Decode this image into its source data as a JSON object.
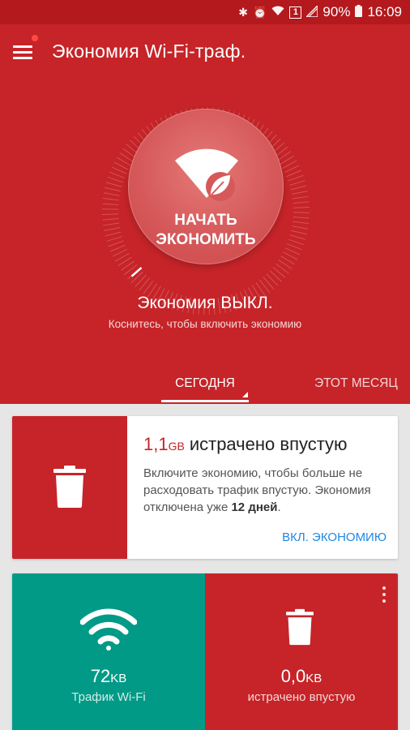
{
  "status_bar": {
    "battery": "90%",
    "time": "16:09",
    "sim_badge": "1",
    "icons": [
      "bluetooth-icon",
      "alarm-icon",
      "wifi-icon",
      "sim-icon",
      "signal-icon",
      "battery-icon"
    ]
  },
  "header": {
    "title": "Экономия Wi-Fi-траф.",
    "start_button": {
      "line1": "НАЧАТЬ",
      "line2": "ЭКОНОМИТЬ"
    },
    "status_title": "Экономия ВЫКЛ.",
    "status_subtitle": "Коснитесь, чтобы включить экономию"
  },
  "tabs": [
    {
      "label": "СЕГОДНЯ",
      "selected": true
    },
    {
      "label": "ЭТОТ МЕСЯЦ",
      "selected": false
    }
  ],
  "wasted_card": {
    "value": "1,1",
    "unit": "GB",
    "headline": "истрачено впустую",
    "desc_part1": "Включите экономию, чтобы больше не расходовать трафик впустую. Экономия отключена уже",
    "desc_days": "12 дней",
    "desc_end": ".",
    "action": "ВКЛ. ЭКОНОМИЮ"
  },
  "stats": [
    {
      "value": "72",
      "unit": "KB",
      "label": "Трафик Wi-Fi",
      "icon": "wifi-icon"
    },
    {
      "value": "0,0",
      "unit": "KB",
      "label": "истрачено впустую",
      "icon": "trash-icon"
    }
  ],
  "colors": {
    "primary_red": "#c62428",
    "status_red": "#b3191d",
    "teal": "#009a87",
    "link_blue": "#1e88e5"
  }
}
